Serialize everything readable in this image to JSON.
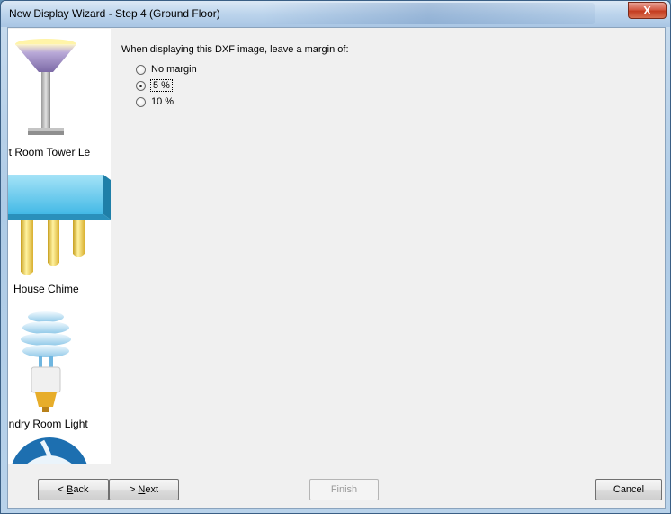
{
  "window": {
    "title": "New Display Wizard - Step 4 (Ground Floor)",
    "close_label": "X"
  },
  "sidebar": {
    "items": [
      {
        "label": "nt Room Tower Le",
        "icon": "floor-lamp-icon"
      },
      {
        "label": "House Chime",
        "icon": "chime-bars-icon"
      },
      {
        "label": "undry Room Light",
        "icon": "cfl-bulb-icon"
      },
      {
        "label": "",
        "icon": "globe-icon"
      }
    ]
  },
  "main": {
    "prompt": "When displaying this DXF image, leave a margin of:",
    "options": [
      {
        "label": "No margin",
        "checked": false
      },
      {
        "label": "5 %",
        "checked": true
      },
      {
        "label": "10 %",
        "checked": false
      }
    ]
  },
  "buttons": {
    "back": {
      "pre": "< ",
      "accel": "B",
      "post": "ack"
    },
    "next": {
      "pre": "> ",
      "accel": "N",
      "post": "ext"
    },
    "finish": "Finish",
    "cancel": "Cancel"
  }
}
